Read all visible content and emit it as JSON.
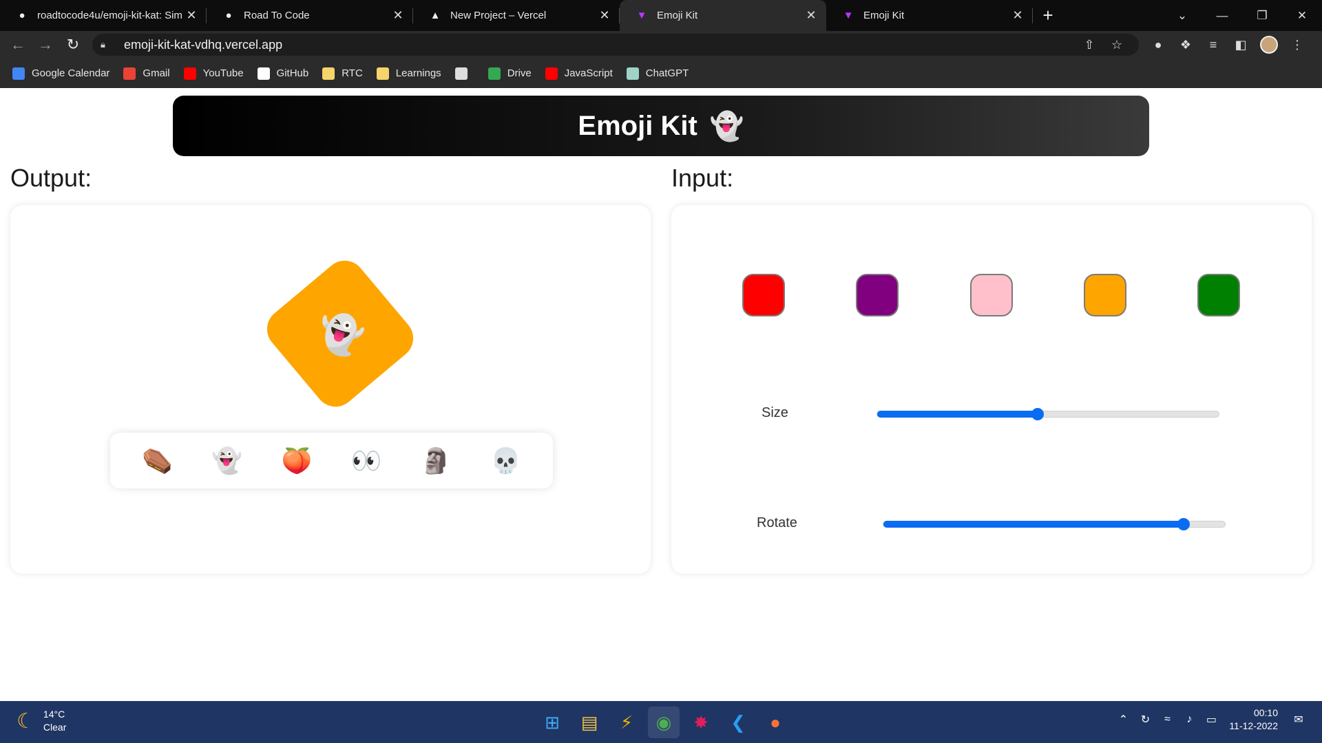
{
  "browser": {
    "tabs": [
      {
        "title": "roadtocode4u/emoji-kit-kat: Sim",
        "icon": "github-icon",
        "active": false
      },
      {
        "title": "Road To Code",
        "icon": "road-to-code-icon",
        "active": false
      },
      {
        "title": "New Project – Vercel",
        "icon": "vercel-icon",
        "active": false
      },
      {
        "title": "Emoji Kit",
        "icon": "vite-icon",
        "active": true
      },
      {
        "title": "Emoji Kit",
        "icon": "vite-icon",
        "active": false
      }
    ],
    "close_glyph": "✕",
    "new_tab_glyph": "+",
    "url": "emoji-kit-kat-vdhq.vercel.app",
    "bookmarks": [
      {
        "label": "Google Calendar",
        "color": "#4285f4"
      },
      {
        "label": "Gmail",
        "color": "#ea4335"
      },
      {
        "label": "YouTube",
        "color": "#ff0000"
      },
      {
        "label": "GitHub",
        "color": "#ffffff"
      },
      {
        "label": "RTC",
        "color": "#f6d36b"
      },
      {
        "label": "Learnings",
        "color": "#f6d36b"
      },
      {
        "label": "",
        "color": "#dddddd"
      },
      {
        "label": "Drive",
        "color": "#34a853"
      },
      {
        "label": "JavaScript",
        "color": "#ff0000"
      },
      {
        "label": "ChatGPT",
        "color": "#9fd3c7"
      }
    ]
  },
  "app": {
    "title": "Emoji Kit",
    "title_emoji": "👻",
    "output_label": "Output:",
    "input_label": "Input:",
    "preview": {
      "color": "#ffa500",
      "emoji": "👻",
      "rotation_deg": -40
    },
    "emoji_options": [
      {
        "emoji": "⚰️",
        "name": "coffin"
      },
      {
        "emoji": "👻",
        "name": "ghost"
      },
      {
        "emoji": "🍑",
        "name": "peach"
      },
      {
        "emoji": "👀",
        "name": "eyes"
      },
      {
        "emoji": "🗿",
        "name": "moai"
      },
      {
        "emoji": "💀",
        "name": "skull"
      }
    ],
    "swatches": [
      {
        "name": "red",
        "color": "#ff0000"
      },
      {
        "name": "purple",
        "color": "#800080"
      },
      {
        "name": "pink",
        "color": "#ffc0cb"
      },
      {
        "name": "orange",
        "color": "#ffa500"
      },
      {
        "name": "green",
        "color": "#008000"
      }
    ],
    "size_label": "Size",
    "size_fraction": 0.47,
    "rotate_label": "Rotate",
    "rotate_fraction": 0.88
  },
  "taskbar": {
    "temperature": "14°C",
    "condition": "Clear",
    "time": "00:10",
    "date": "11-12-2022"
  }
}
